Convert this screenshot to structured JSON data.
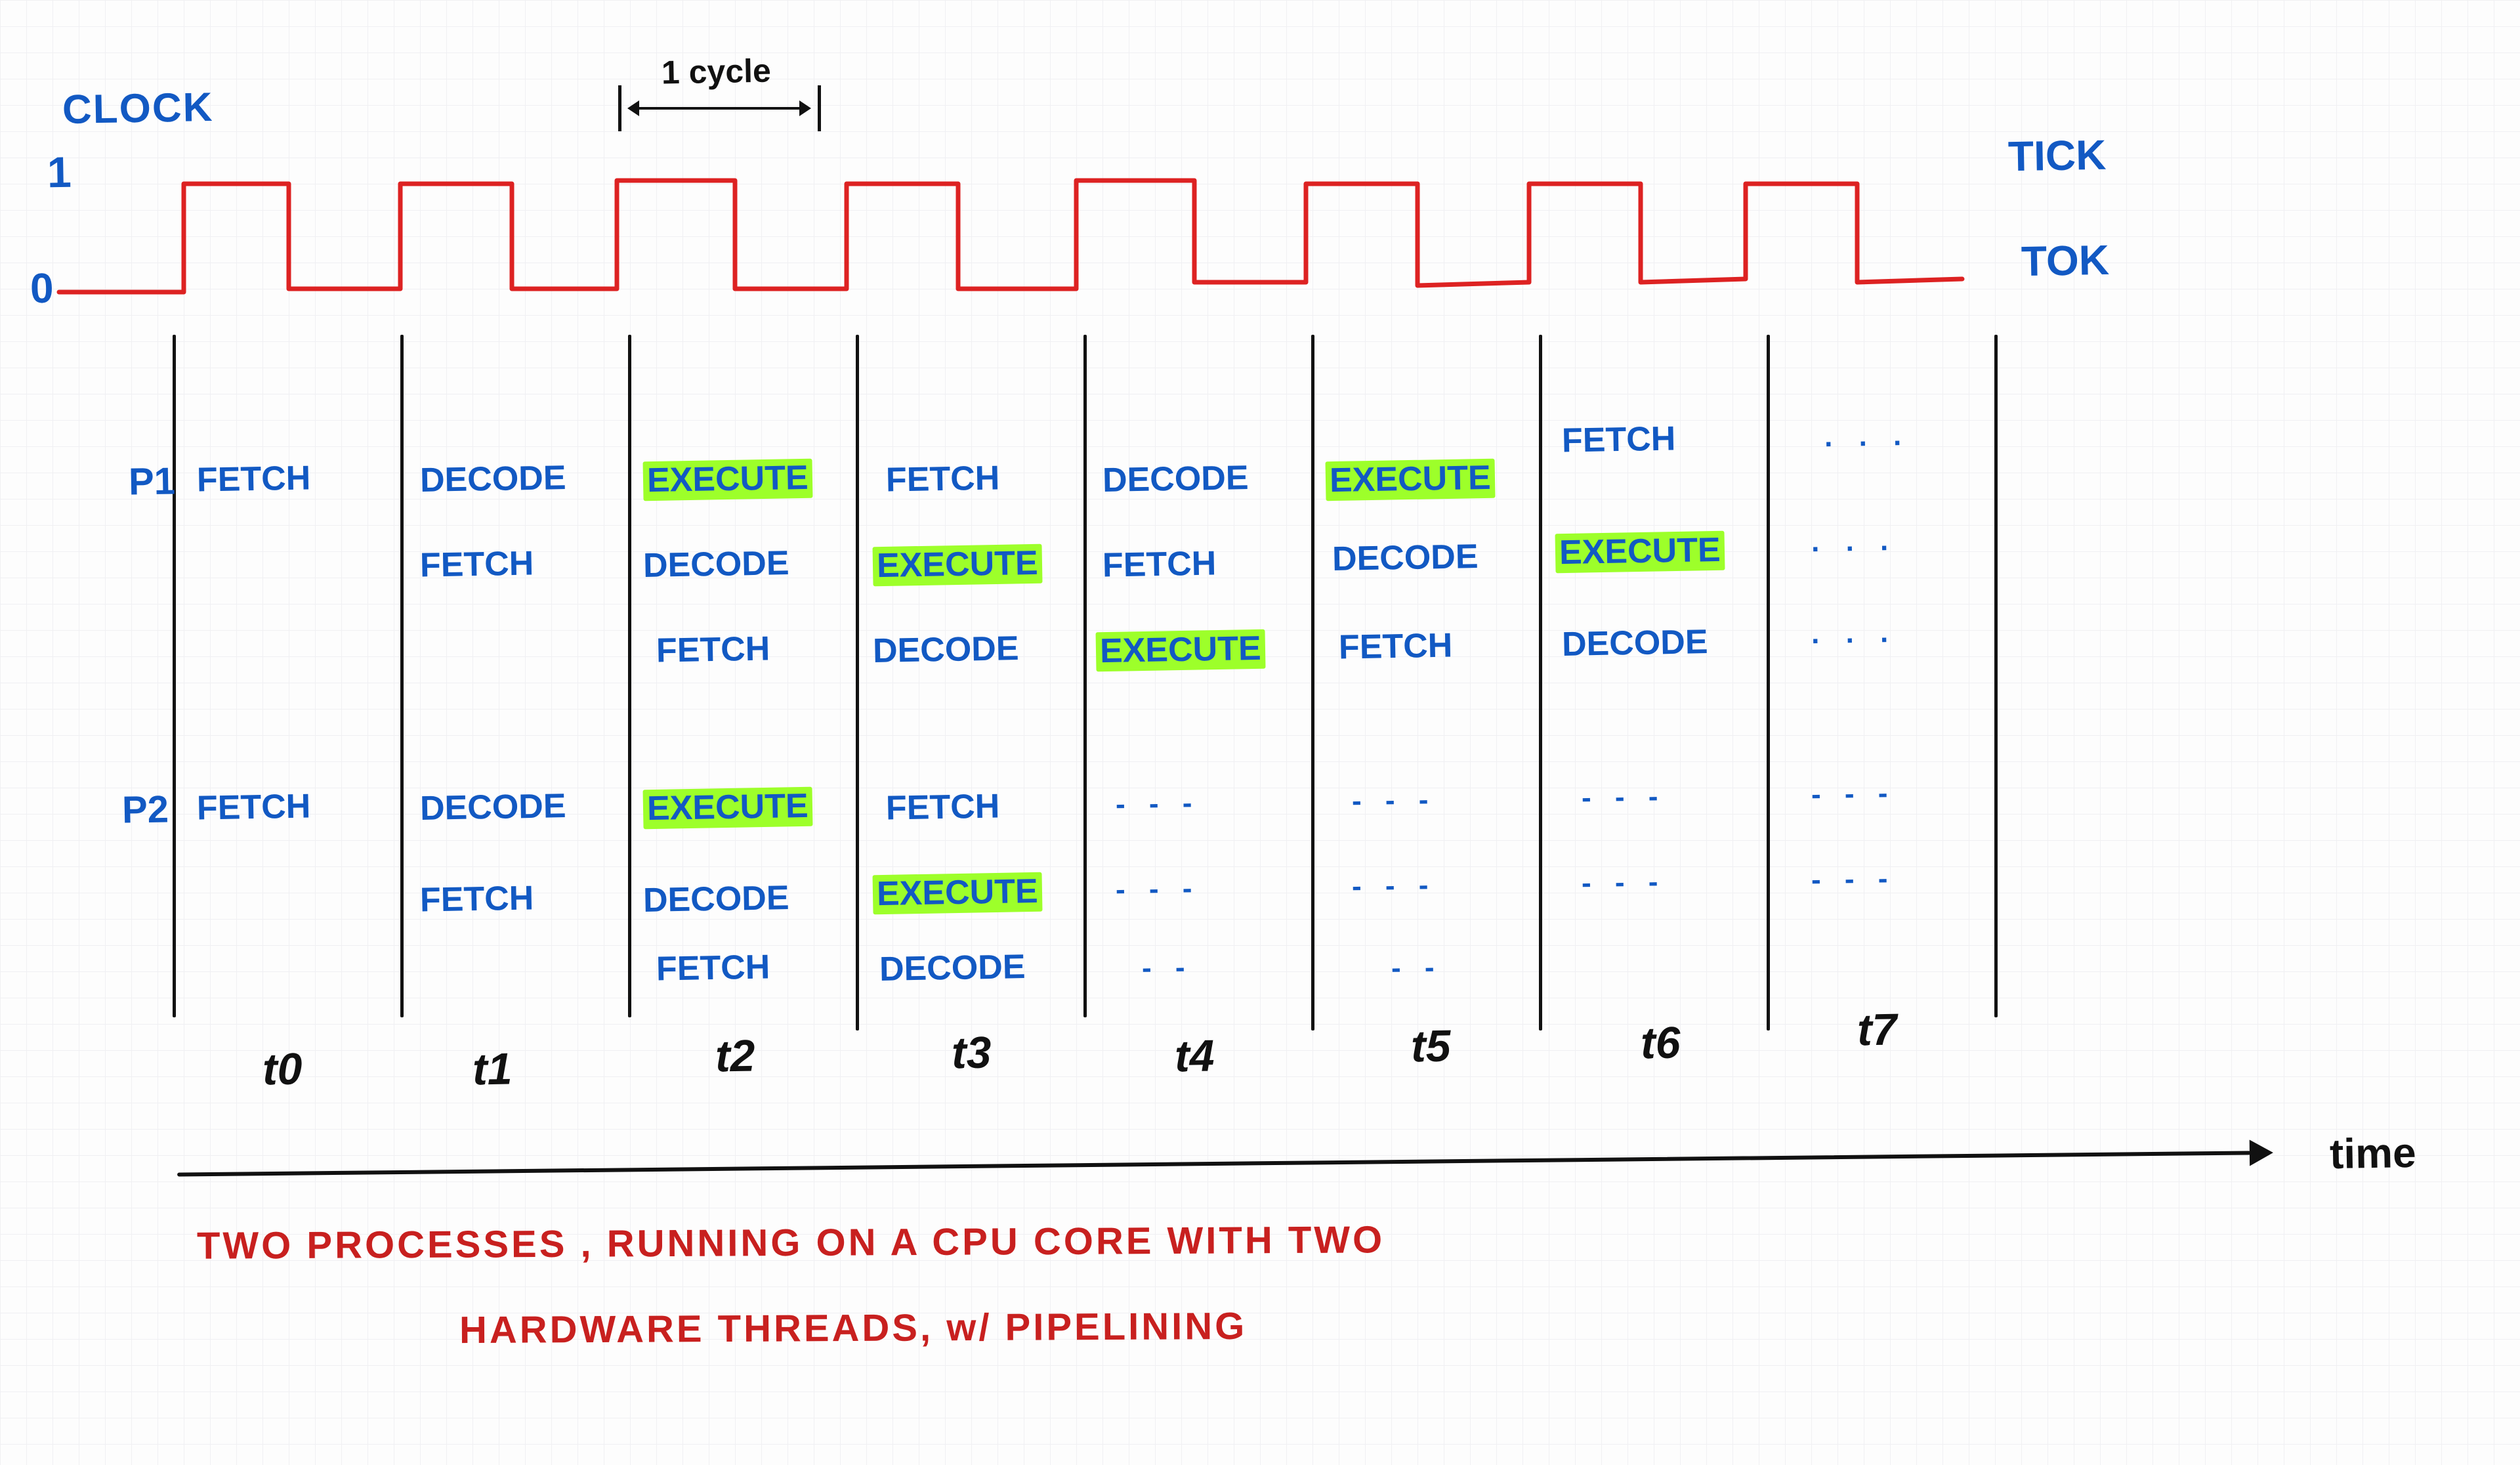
{
  "header": {
    "clock": "CLOCK",
    "one": "1",
    "zero": "0",
    "tick": "TICK",
    "tok": "TOK",
    "cycle": "1 cycle"
  },
  "rows": {
    "p1": "P1",
    "p2": "P2"
  },
  "stages": {
    "fetch": "FETCH",
    "decode": "DECODE",
    "execute": "EXECUTE"
  },
  "ticks": [
    "t0",
    "t1",
    "t2",
    "t3",
    "t4",
    "t5",
    "t6",
    "t7"
  ],
  "axis_label": "time",
  "caption1": "TWO PROCESSES , RUNNING ON A CPU CORE WITH TWO",
  "caption2": "HARDWARE THREADS, w/ PIPELINING",
  "chart_data": {
    "type": "table",
    "title": "Two processes running on a CPU core with two hardware threads, with pipelining",
    "time_steps": [
      "t0",
      "t1",
      "t2",
      "t3",
      "t4",
      "t5",
      "t6",
      "t7"
    ],
    "processes": {
      "P1": {
        "pipeline1": [
          "FETCH",
          "DECODE",
          "EXECUTE",
          "FETCH",
          "DECODE",
          "EXECUTE",
          "FETCH",
          "..."
        ],
        "pipeline2": [
          null,
          "FETCH",
          "DECODE",
          "EXECUTE",
          "FETCH",
          "DECODE",
          "EXECUTE",
          "..."
        ],
        "pipeline3": [
          null,
          null,
          "FETCH",
          "DECODE",
          "EXECUTE",
          "FETCH",
          "DECODE",
          "..."
        ]
      },
      "P2": {
        "pipeline1": [
          "FETCH",
          "DECODE",
          "EXECUTE",
          "FETCH",
          "...",
          "...",
          "...",
          "..."
        ],
        "pipeline2": [
          null,
          "FETCH",
          "DECODE",
          "EXECUTE",
          "...",
          "...",
          "...",
          "..."
        ],
        "pipeline3": [
          null,
          null,
          "FETCH",
          "DECODE",
          "...",
          "...",
          null,
          null
        ]
      }
    },
    "clock": {
      "levels": [
        "0",
        "1"
      ],
      "label_high": "TICK",
      "label_low": "TOK",
      "period_label": "1 cycle"
    }
  }
}
